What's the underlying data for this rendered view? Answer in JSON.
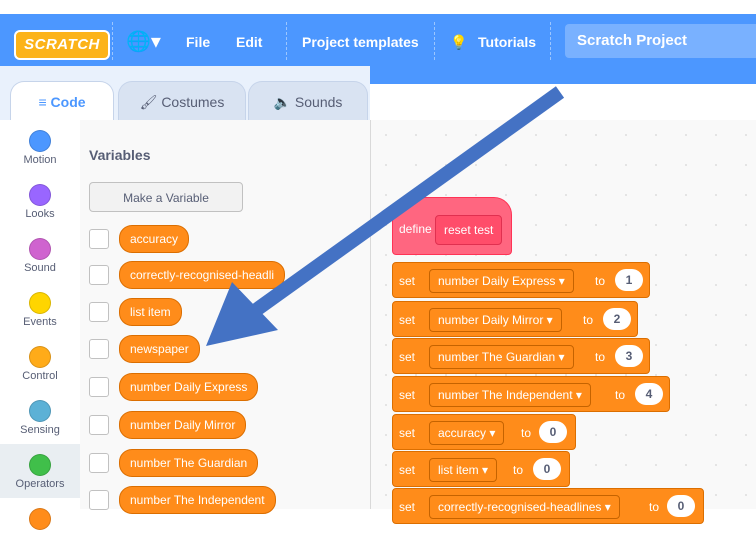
{
  "menubar": {
    "logo": "SCRATCH",
    "globe_icon": "globe-icon",
    "items": {
      "file": "File",
      "edit": "Edit",
      "templates": "Project templates",
      "tutorials": "Tutorials"
    },
    "project_title": "Scratch Project",
    "accent": "#4c97ff"
  },
  "tabs": {
    "code": "Code",
    "costumes": "Costumes",
    "sounds": "Sounds"
  },
  "categories": [
    {
      "label": "Motion",
      "color": "#4c97ff"
    },
    {
      "label": "Looks",
      "color": "#9966ff"
    },
    {
      "label": "Sound",
      "color": "#cf63cf"
    },
    {
      "label": "Events",
      "color": "#ffd500"
    },
    {
      "label": "Control",
      "color": "#ffab19"
    },
    {
      "label": "Sensing",
      "color": "#5cb1d6"
    },
    {
      "label": "Operators",
      "color": "#40bf4a"
    }
  ],
  "palette": {
    "title": "Variables",
    "make_variable": "Make a Variable",
    "variables": [
      "accuracy",
      "correctly-recognised-headli",
      "list item",
      "newspaper",
      "number Daily Express",
      "number Daily Mirror",
      "number The Guardian",
      "number The Independent"
    ]
  },
  "script": {
    "define_label": "define",
    "define_name": "reset test",
    "set_label": "set",
    "to_label": "to",
    "sets": [
      {
        "var": "number Daily Express ▾",
        "value": "1"
      },
      {
        "var": "number Daily Mirror ▾",
        "value": "2"
      },
      {
        "var": "number The Guardian ▾",
        "value": "3"
      },
      {
        "var": "number The Independent ▾",
        "value": "4"
      },
      {
        "var": "accuracy ▾",
        "value": "0"
      },
      {
        "var": "list item ▾",
        "value": "0"
      },
      {
        "var": "correctly-recognised-headlines ▾",
        "value": "0"
      }
    ]
  },
  "annotation": {
    "arrow_color": "#4472c4"
  }
}
